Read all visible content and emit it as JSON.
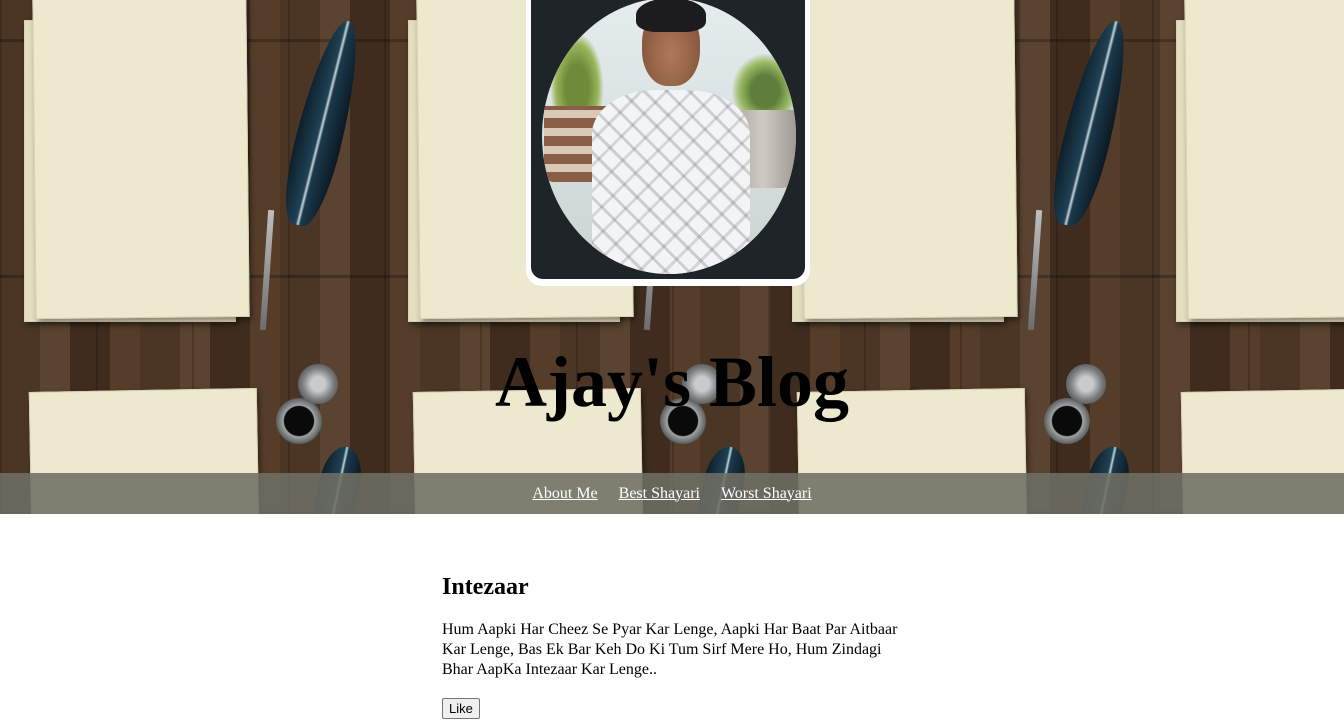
{
  "header": {
    "title": "Ajay's Blog",
    "background_theme": "wooden desk with parchment papers, quill and inkwell",
    "avatar": "profile photo"
  },
  "nav": {
    "items": [
      {
        "label": "About Me"
      },
      {
        "label": "Best Shayari"
      },
      {
        "label": "Worst Shayari"
      }
    ]
  },
  "post": {
    "title": "Intezaar",
    "body": "Hum Aapki Har Cheez Se Pyar Kar Lenge, Aapki Har Baat Par Aitbaar Kar Lenge, Bas Ek Bar Keh Do Ki Tum Sirf Mere Ho, Hum Zindagi Bhar AapKa Intezaar Kar Lenge..",
    "like_label": "Like"
  },
  "colors": {
    "nav_bar": "#6e6e64",
    "nav_link": "#ffffff",
    "wood": "#4a3524",
    "paper": "#ede9ce",
    "avatar_bg": "#1f2428"
  }
}
